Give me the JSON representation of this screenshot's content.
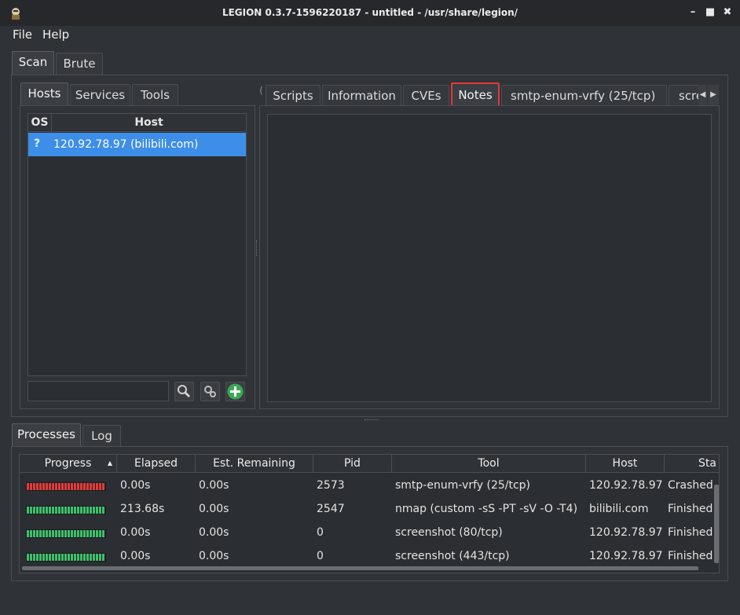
{
  "window": {
    "title": "LEGION 0.3.7-1596220187 - untitled - /usr/share/legion/",
    "controls": {
      "minimize": "–",
      "maximize": "■",
      "close": "✖"
    }
  },
  "menu": [
    "File",
    "Help"
  ],
  "main_tabs": [
    "Scan",
    "Brute"
  ],
  "left_tabs": [
    "Hosts",
    "Services",
    "Tools"
  ],
  "hosts_table": {
    "headers": [
      "OS",
      "Host"
    ],
    "rows": [
      {
        "os": "?",
        "host": "120.92.78.97 (bilibili.com)"
      }
    ]
  },
  "right_tabs": [
    "Scripts",
    "Information",
    "CVEs",
    "Notes",
    "smtp-enum-vrfy (25/tcp)",
    "scre"
  ],
  "bottom_tabs": [
    "Processes",
    "Log"
  ],
  "processes": {
    "headers": [
      "Progress",
      "Elapsed",
      "Est. Remaining",
      "Pid",
      "Tool",
      "Host",
      "Sta"
    ],
    "rows": [
      {
        "status_color": "#e23b3b",
        "elapsed": "0.00s",
        "remaining": "0.00s",
        "pid": "2573",
        "tool": "smtp-enum-vrfy (25/tcp)",
        "host": "120.92.78.97",
        "status": "Crashed"
      },
      {
        "status_color": "#3fbf6a",
        "elapsed": "213.68s",
        "remaining": "0.00s",
        "pid": "2547",
        "tool": "nmap (custom -sS -PT -sV -O -T4)",
        "host": "bilibili.com",
        "status": "Finished"
      },
      {
        "status_color": "#3fbf6a",
        "elapsed": "0.00s",
        "remaining": "0.00s",
        "pid": "0",
        "tool": "screenshot (80/tcp)",
        "host": "120.92.78.97",
        "status": "Finished"
      },
      {
        "status_color": "#3fbf6a",
        "elapsed": "0.00s",
        "remaining": "0.00s",
        "pid": "0",
        "tool": "screenshot (443/tcp)",
        "host": "120.92.78.97",
        "status": "Finished"
      }
    ]
  },
  "colors": {
    "selection": "#3d8ee8",
    "highlight": "#e0393b"
  },
  "icons": [
    "search-icon",
    "gear-icon",
    "add-icon"
  ]
}
